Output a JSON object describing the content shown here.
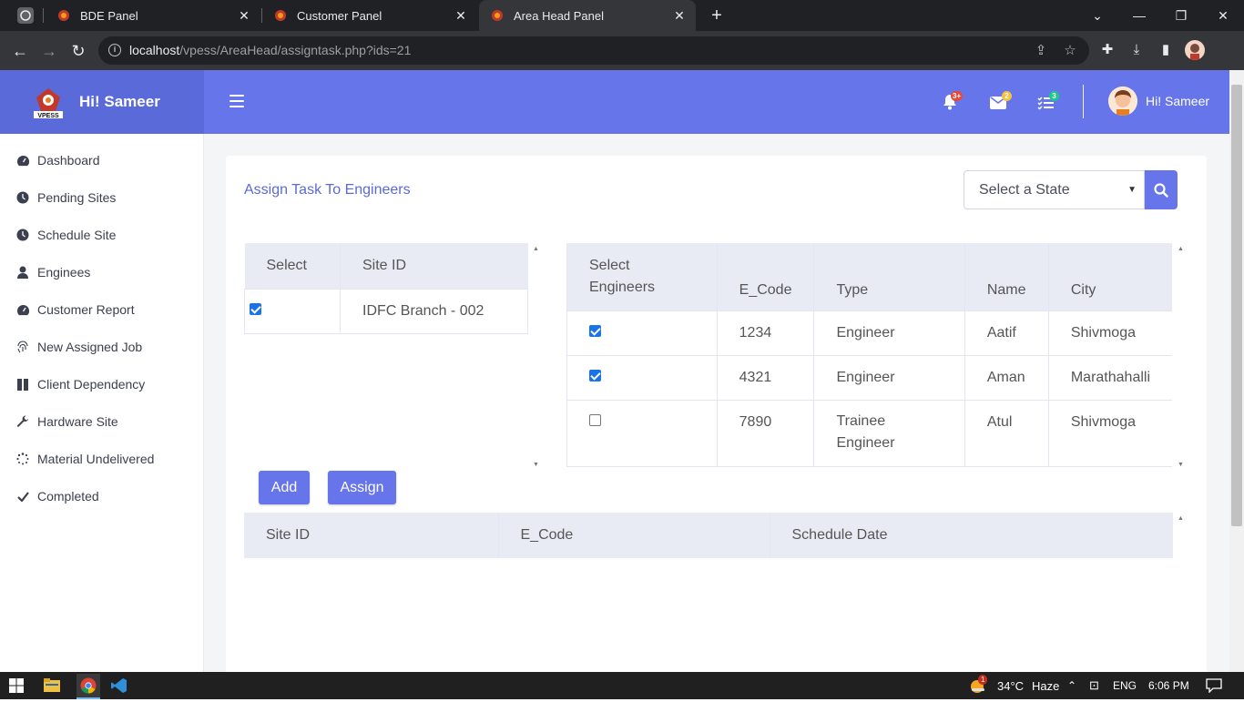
{
  "browser": {
    "tabs": [
      {
        "title": "BDE Panel"
      },
      {
        "title": "Customer Panel"
      },
      {
        "title": "Area Head Panel"
      }
    ],
    "url_host": "localhost",
    "url_path": "/vpess/AreaHead/assigntask.php?ids=21"
  },
  "brand": {
    "logo_text": "VPESS",
    "greeting": "Hi! Sameer"
  },
  "topbar": {
    "alerts_badge": "3+",
    "messages_badge": "2",
    "tasks_badge": "3",
    "user_name": "Hi! Sameer",
    "colors": {
      "primary": "#6675ea",
      "brand": "#5a6ad8",
      "alerts": "#e74a3b",
      "messages": "#f6c23e",
      "tasks": "#1cc88a"
    }
  },
  "sidebar": {
    "items": [
      {
        "label": "Dashboard",
        "icon": "dashboard-icon"
      },
      {
        "label": "Pending Sites",
        "icon": "clock-icon"
      },
      {
        "label": "Schedule Site",
        "icon": "clock-icon"
      },
      {
        "label": "Enginees",
        "icon": "user-icon"
      },
      {
        "label": "Customer Report",
        "icon": "dashboard-icon"
      },
      {
        "label": "New Assigned Job",
        "icon": "fingerprint-icon"
      },
      {
        "label": "Client Dependency",
        "icon": "columns-icon"
      },
      {
        "label": "Hardware Site",
        "icon": "wrench-icon"
      },
      {
        "label": "Material Undelivered",
        "icon": "spinner-icon"
      },
      {
        "label": "Completed",
        "icon": "check-icon"
      }
    ]
  },
  "main": {
    "title": "Assign Task To Engineers",
    "state_select": {
      "selected": "Select a State"
    },
    "sites_table": {
      "headers": [
        "Select",
        "Site ID"
      ],
      "rows": [
        {
          "checked": true,
          "site_id": "IDFC Branch - 002"
        }
      ]
    },
    "engineers_table": {
      "headers": [
        "Select Engineers",
        "E_Code",
        "Type",
        "Name",
        "City"
      ],
      "rows": [
        {
          "checked": true,
          "e_code": "1234",
          "type": "Engineer",
          "name": "Aatif",
          "city": "Shivmoga"
        },
        {
          "checked": true,
          "e_code": "4321",
          "type": "Engineer",
          "name": "Aman",
          "city": "Marathahalli"
        },
        {
          "checked": false,
          "e_code": "7890",
          "type": "Trainee Engineer",
          "name": "Atul",
          "city": "Shivmoga"
        }
      ]
    },
    "buttons": {
      "add": "Add",
      "assign": "Assign"
    },
    "assigned_table": {
      "headers": [
        "Site ID",
        "E_Code",
        "Schedule Date"
      ]
    }
  },
  "taskbar": {
    "weather_temp": "34°C",
    "weather_desc": "Haze",
    "weather_badge": "1",
    "lang": "ENG",
    "time": "6:06 PM"
  }
}
